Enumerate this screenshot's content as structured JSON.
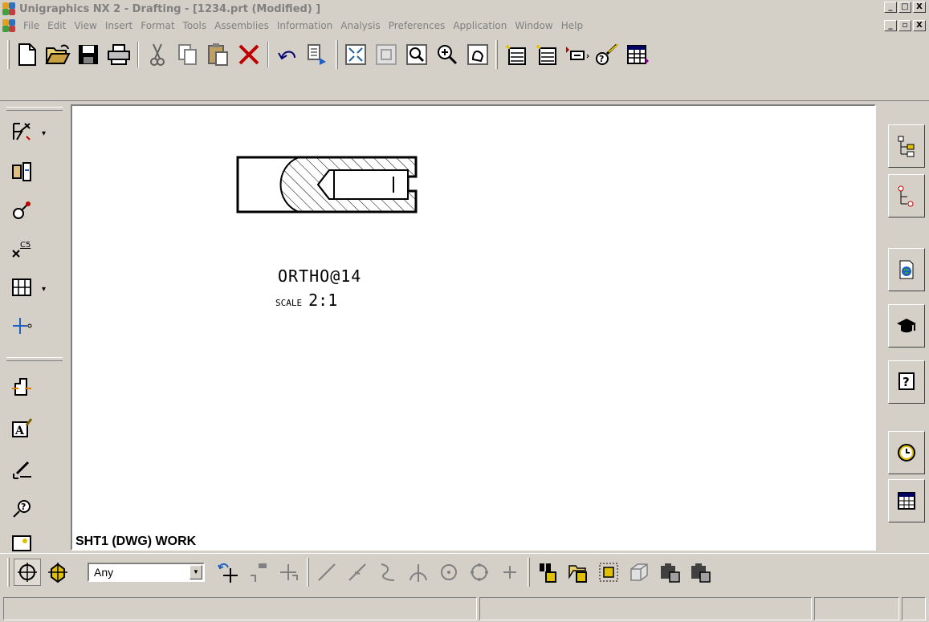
{
  "window": {
    "title": "Unigraphics NX 2 - Drafting - [1234.prt (Modified) ]",
    "buttons": [
      "_",
      "□",
      "X"
    ],
    "doc_buttons": [
      "_",
      "▫",
      "X"
    ]
  },
  "menu": {
    "items": [
      "File",
      "Edit",
      "View",
      "Insert",
      "Format",
      "Tools",
      "Assemblies",
      "Information",
      "Analysis",
      "Preferences",
      "Application",
      "Window",
      "Help"
    ]
  },
  "toolbar": {
    "icons": [
      "new-icon",
      "open-icon",
      "save-icon",
      "print-icon",
      "cut-icon",
      "copy-icon",
      "paste-icon",
      "delete-icon",
      "undo-icon",
      "redo-list-icon",
      "fit-icon",
      "zoom-in-window-icon",
      "zoom-region-icon",
      "zoom-icon",
      "pan-icon",
      "new-sheet-icon",
      "open-sheet-icon",
      "edit-sheet-icon",
      "display-sheet-icon",
      "sheet-table-icon"
    ]
  },
  "left_toolbar": {
    "icons": [
      "section-line-icon",
      "base-view-icon",
      "detail-view-icon",
      "break-line-icon",
      "projected-view-icon",
      "centerline-icon",
      "utility-symbol-icon",
      "annotation-icon",
      "leader-icon",
      "info-icon",
      "image-icon"
    ]
  },
  "drawing": {
    "view_label": "ORTHO@14",
    "scale_label": "SCALE",
    "scale_value": "2:1",
    "sheet_label": "SHT1 (DWG) WORK"
  },
  "right_toolbar": {
    "tabs": [
      "assembly-navigator-icon",
      "part-navigator-icon",
      "web-browser-icon",
      "training-icon",
      "help-icon",
      "history-icon",
      "system-materials-icon"
    ]
  },
  "selection_toolbar": {
    "filter": "Any"
  },
  "colors": {
    "face": "#d4d0c8",
    "canvas": "#ffffff",
    "title_text": "#808080"
  }
}
